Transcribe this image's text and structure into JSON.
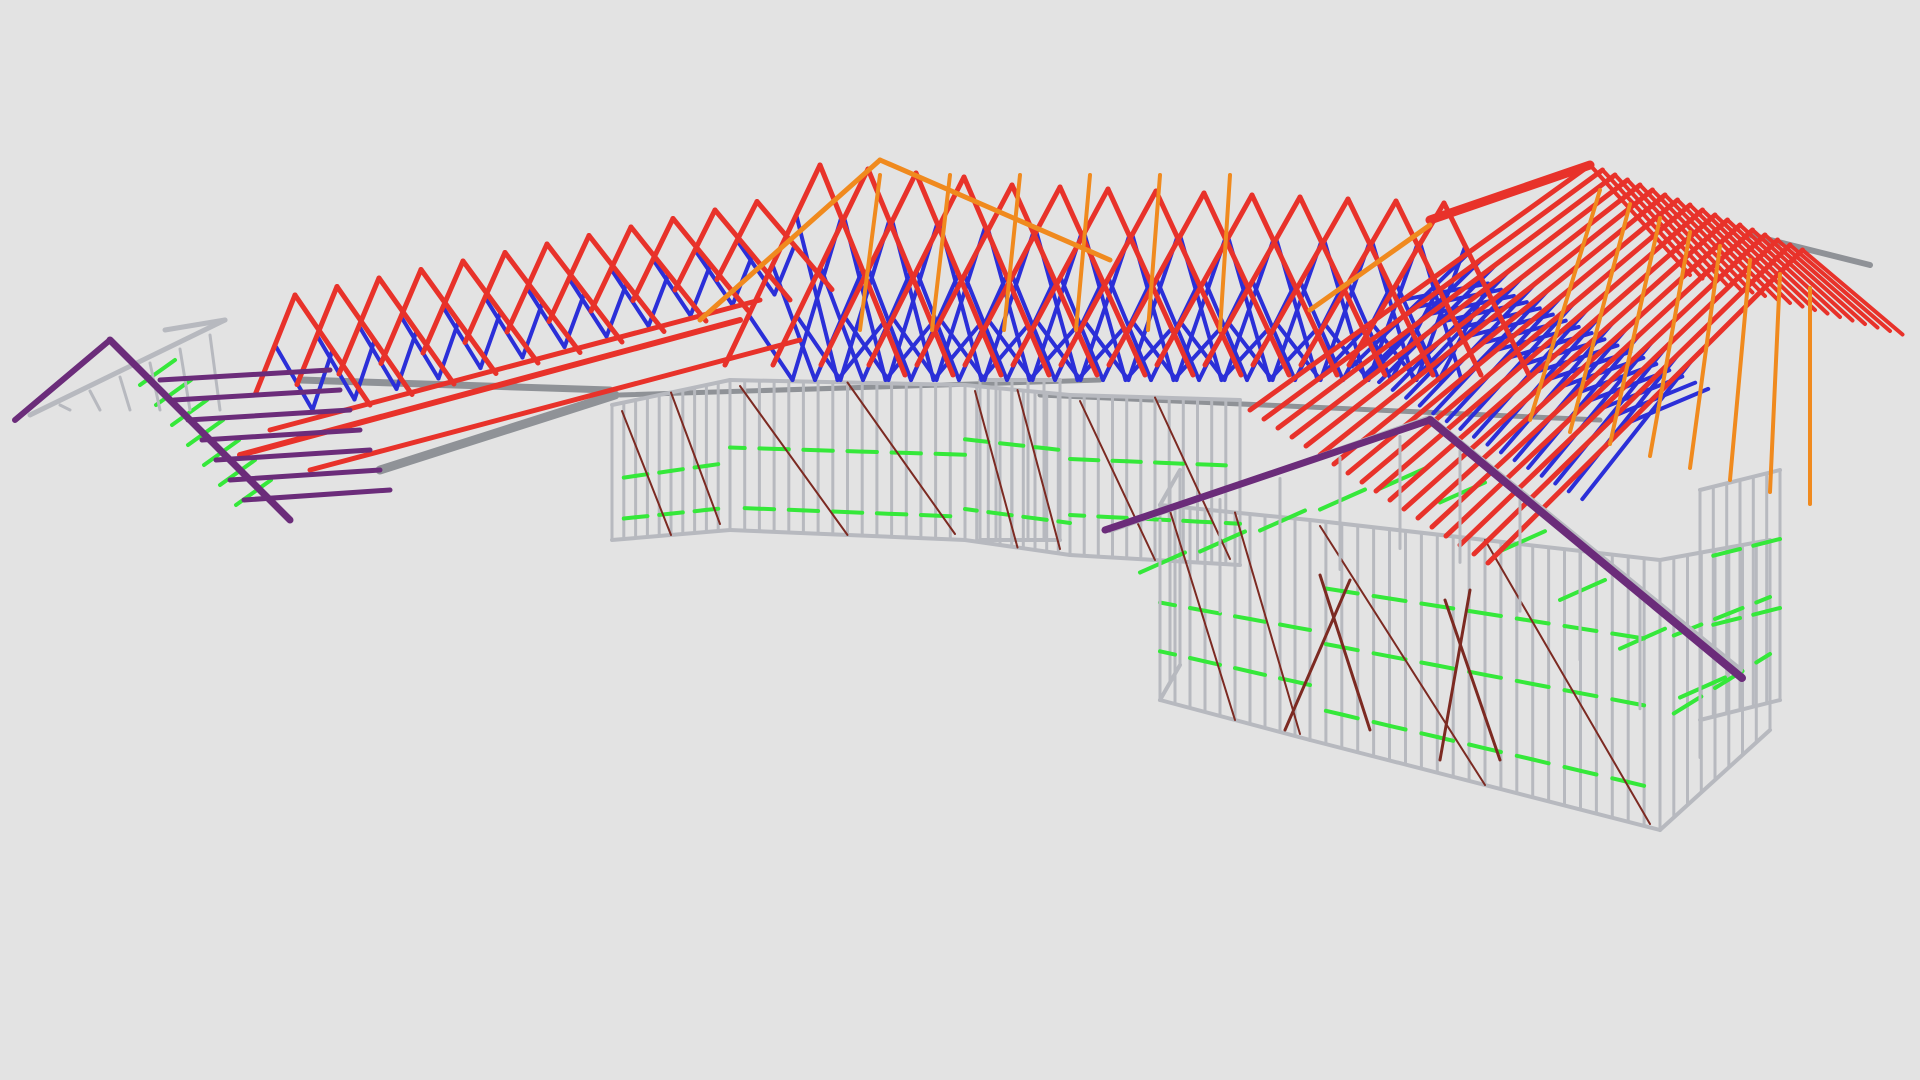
{
  "scene": {
    "subject": "steel-frame-house-model",
    "background": "#e3e3e3",
    "member_colors": {
      "truss_chord": "#e8322a",
      "truss_web": "#2b2fd8",
      "wall_frame": "#b7b9bf",
      "noggin": "#35e83a",
      "fascia": "#6b2c7a",
      "bracing": "#7c2a22",
      "hip_member": "#f08a1e",
      "beam": "#8f9297"
    }
  }
}
